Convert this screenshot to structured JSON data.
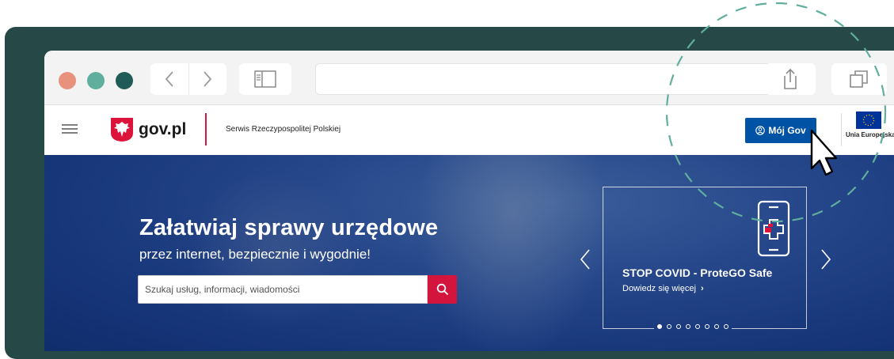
{
  "browser": {
    "traffic_lights": [
      "#e8917c",
      "#5fae9e",
      "#1f5c57"
    ],
    "back_icon": "chevron-left-icon",
    "forward_icon": "chevron-right-icon",
    "sidebar_icon": "sidebar-icon",
    "reload_icon": "reload-icon",
    "share_icon": "share-icon",
    "tabs_icon": "tabs-icon"
  },
  "header": {
    "logo_text": "gov.pl",
    "tagline": "Serwis Rzeczypospolitej Polskiej",
    "moj_gov": "Mój Gov",
    "eu_label": "Unia Europejska"
  },
  "hero": {
    "headline": "Załatwiaj sprawy urzędowe",
    "subline": "przez internet, bezpiecznie i wygodnie!",
    "search_placeholder": "Szukaj usług, informacji, wiadomości"
  },
  "card": {
    "title": "STOP COVID - ProteGO Safe",
    "link": "Dowiedz się więcej",
    "link_arrow": "›",
    "dots_total": 8,
    "dots_active": 1
  },
  "colors": {
    "frame": "#264846",
    "brand_blue": "#0052a5",
    "brand_red": "#d3143c"
  }
}
